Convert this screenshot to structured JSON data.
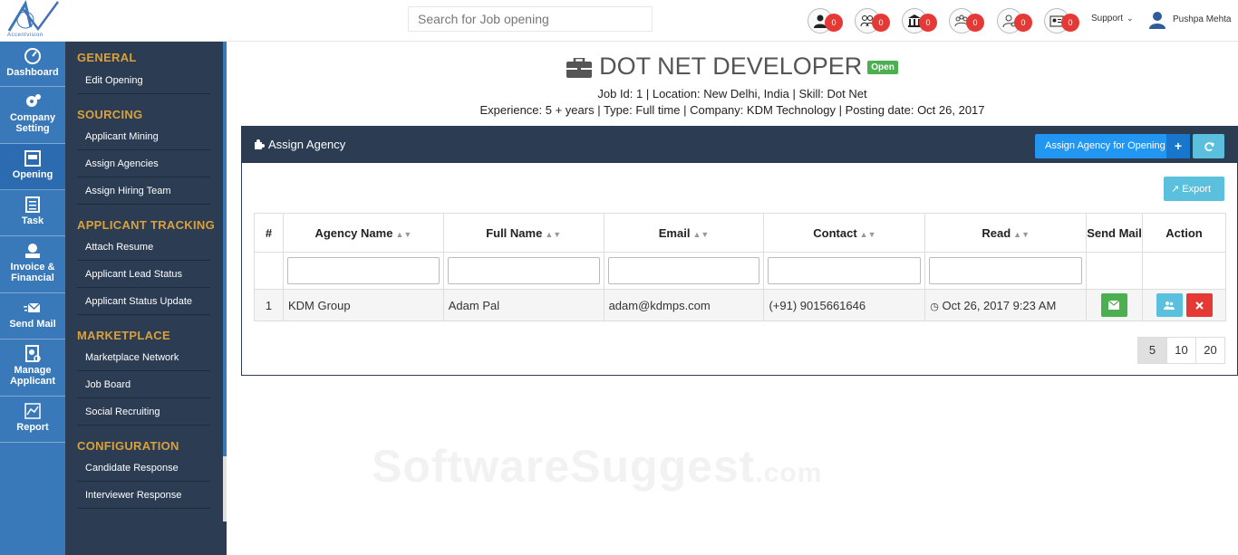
{
  "header": {
    "logo_tagline": "Accentvision",
    "search_placeholder": "Search for Job opening",
    "notifications": [
      {
        "icon": "user-icon",
        "count": "0"
      },
      {
        "icon": "users-icon",
        "count": "0"
      },
      {
        "icon": "bank-icon",
        "count": "0"
      },
      {
        "icon": "team-icon",
        "count": "0"
      },
      {
        "icon": "user-search-icon",
        "count": "0"
      },
      {
        "icon": "id-card-icon",
        "count": "0"
      }
    ],
    "support_label": "Support",
    "user_name": "Pushpa Mehta"
  },
  "iconnav": [
    {
      "label": "Dashboard"
    },
    {
      "label": "Company Setting"
    },
    {
      "label": "Opening"
    },
    {
      "label": "Task"
    },
    {
      "label": "Invoice & Financial"
    },
    {
      "label": "Send Mail"
    },
    {
      "label": "Manage Applicant"
    },
    {
      "label": "Report"
    }
  ],
  "submenu": {
    "sections": [
      {
        "title": "GENERAL",
        "items": [
          "Edit Opening"
        ]
      },
      {
        "title": "SOURCING",
        "items": [
          "Applicant Mining",
          "Assign Agencies",
          "Assign Hiring Team"
        ]
      },
      {
        "title": "APPLICANT TRACKING",
        "items": [
          "Attach Resume",
          "Applicant Lead Status",
          "Applicant Status Update"
        ]
      },
      {
        "title": "MARKETPLACE",
        "items": [
          "Marketplace Network",
          "Job Board",
          "Social Recruiting"
        ]
      },
      {
        "title": "CONFIGURATION",
        "items": [
          "Candidate Response",
          "Interviewer Response"
        ]
      }
    ]
  },
  "job": {
    "title": "DOT NET DEVELOPER",
    "status": "Open",
    "meta_line1": "Job Id: 1 | Location: New Delhi, India | Skill: Dot Net",
    "meta_line2": "Experience: 5 + years | Type: Full time | Company: KDM Technology | Posting date: Oct 26, 2017"
  },
  "panel": {
    "title": "Assign Agency",
    "assign_button": "Assign Agency for Opening",
    "export_button": "Export",
    "columns": [
      "#",
      "Agency Name",
      "Full Name",
      "Email",
      "Contact",
      "Read",
      "Send Mail",
      "Action"
    ],
    "rows": [
      {
        "num": "1",
        "agency": "KDM Group",
        "full_name": "Adam Pal",
        "email": "adam@kdmps.com",
        "contact": "(+91) 9015661646",
        "read": "Oct 26, 2017 9:23 AM"
      }
    ],
    "page_sizes": [
      "5",
      "10",
      "20"
    ],
    "selected_page_size": "5"
  },
  "watermark": {
    "main": "SoftwareSuggest",
    "suffix": ".com"
  },
  "colors": {
    "nav_blue": "#3a79b9",
    "submenu_bg": "#2b3c53",
    "section_gold": "#d9a13b",
    "badge_red": "#e53935"
  }
}
